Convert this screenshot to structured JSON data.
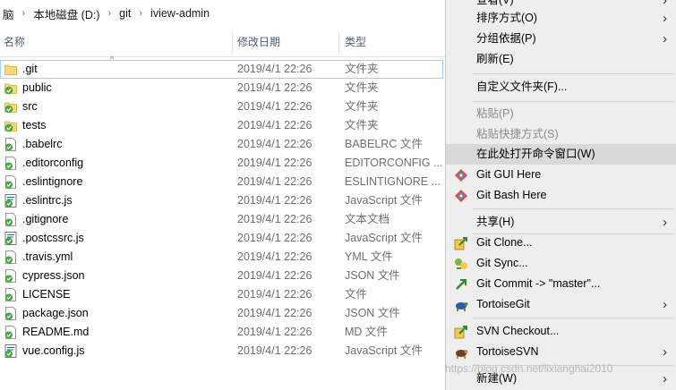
{
  "breadcrumb": [
    "脑",
    "本地磁盘 (D:)",
    "git",
    "iview-admin"
  ],
  "columns": {
    "name": "名称",
    "date": "修改日期",
    "type": "类型"
  },
  "files": [
    {
      "name": ".git",
      "date": "2019/4/1 22:26",
      "type": "文件夹",
      "icon": "folder-icon"
    },
    {
      "name": "public",
      "date": "2019/4/1 22:26",
      "type": "文件夹",
      "icon": "folder-check-icon"
    },
    {
      "name": "src",
      "date": "2019/4/1 22:26",
      "type": "文件夹",
      "icon": "folder-check-icon"
    },
    {
      "name": "tests",
      "date": "2019/4/1 22:26",
      "type": "文件夹",
      "icon": "folder-check-icon"
    },
    {
      "name": ".babelrc",
      "date": "2019/4/1 22:26",
      "type": "BABELRC 文件",
      "icon": "file-check-icon"
    },
    {
      "name": ".editorconfig",
      "date": "2019/4/1 22:26",
      "type": "EDITORCONFIG ...",
      "icon": "file-check-icon"
    },
    {
      "name": ".eslintignore",
      "date": "2019/4/1 22:26",
      "type": "ESLINTIGNORE ...",
      "icon": "file-check-icon"
    },
    {
      "name": ".eslintrc.js",
      "date": "2019/4/1 22:26",
      "type": "JavaScript 文件",
      "icon": "script-check-icon"
    },
    {
      "name": ".gitignore",
      "date": "2019/4/1 22:26",
      "type": "文本文档",
      "icon": "file-check-icon"
    },
    {
      "name": ".postcssrc.js",
      "date": "2019/4/1 22:26",
      "type": "JavaScript 文件",
      "icon": "script-check-icon"
    },
    {
      "name": ".travis.yml",
      "date": "2019/4/1 22:26",
      "type": "YML 文件",
      "icon": "file-check-icon"
    },
    {
      "name": "cypress.json",
      "date": "2019/4/1 22:26",
      "type": "JSON 文件",
      "icon": "file-check-icon"
    },
    {
      "name": "LICENSE",
      "date": "2019/4/1 22:26",
      "type": "文件",
      "icon": "file-check-icon"
    },
    {
      "name": "package.json",
      "date": "2019/4/1 22:26",
      "type": "JSON 文件",
      "icon": "file-check-icon"
    },
    {
      "name": "README.md",
      "date": "2019/4/1 22:26",
      "type": "MD 文件",
      "icon": "file-check-icon"
    },
    {
      "name": "vue.config.js",
      "date": "2019/4/1 22:26",
      "type": "JavaScript 文件",
      "icon": "script-check-icon"
    }
  ],
  "menu": {
    "view": "查看(V)",
    "sort": "排序方式(O)",
    "group": "分组依据(P)",
    "refresh": "刷新(E)",
    "customize": "自定义文件夹(F)...",
    "paste": "粘贴(P)",
    "paste_shortcut": "粘贴快捷方式(S)",
    "open_cmd": "在此处打开命令窗口(W)",
    "git_gui": "Git GUI Here",
    "git_bash": "Git Bash Here",
    "share": "共享(H)",
    "git_clone": "Git Clone...",
    "git_sync": "Git Sync...",
    "git_commit": "Git Commit -> \"master\"...",
    "tortoisegit": "TortoiseGit",
    "svn_checkout": "SVN Checkout...",
    "tortoisesvn": "TortoiseSVN",
    "new": "新建(W)"
  },
  "watermark": "https://blog.csdn.net/lixianghai2010",
  "colors": {
    "selection_border": "#99d1ff",
    "menu_bg": "#eeeeee",
    "menu_highlight": "#d9d9d9",
    "folder": "#f2c94c",
    "check": "#3cab37"
  }
}
